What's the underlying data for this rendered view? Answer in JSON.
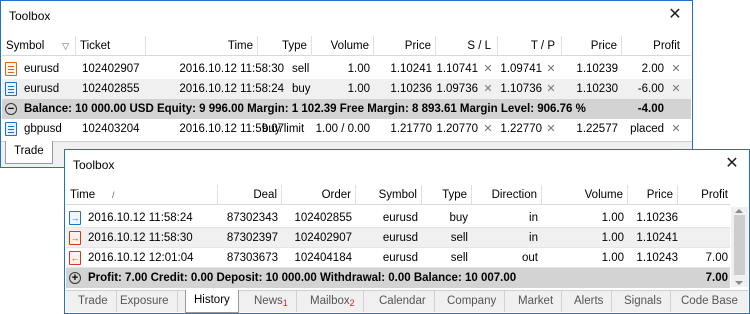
{
  "win1": {
    "title": "Toolbox",
    "headers": [
      "Symbol",
      "Ticket",
      "Time",
      "Type",
      "Volume",
      "Price",
      "S / L",
      "T / P",
      "Price",
      "Profit"
    ],
    "sort_arrow": "▽",
    "rows": [
      {
        "icon": "sell-order-icon",
        "symbol": "eurusd",
        "ticket": "102402907",
        "time": "2016.10.12 11:58:30",
        "type": "sell",
        "volume": "1.00",
        "price": "1.10241",
        "sl": "1.10741",
        "tp": "1.09741",
        "cur": "1.10239",
        "profit": "2.00"
      },
      {
        "icon": "buy-order-icon",
        "symbol": "eurusd",
        "ticket": "102402855",
        "time": "2016.10.12 11:58:24",
        "type": "buy",
        "volume": "1.00",
        "price": "1.10236",
        "sl": "1.09736",
        "tp": "1.10736",
        "cur": "1.10230",
        "profit": "-6.00"
      },
      {
        "icon": "pending-order-icon",
        "symbol": "gbpusd",
        "ticket": "102403204",
        "time": "2016.10.12 11:59:07",
        "type": "buy limit",
        "volume": "1.00 / 0.00",
        "price": "1.21770",
        "sl": "1.20770",
        "tp": "1.22770",
        "cur": "1.22577",
        "profit": "placed"
      }
    ],
    "summary": {
      "text": "Balance: 10 000.00 USD  Equity: 9 996.00  Margin: 1 102.39  Free Margin: 8 893.61  Margin Level: 906.76 %",
      "profit": "-4.00"
    },
    "tab": "Trade"
  },
  "win2": {
    "title": "Toolbox",
    "headers": [
      "Time",
      "Deal",
      "Order",
      "Symbol",
      "Type",
      "Direction",
      "Volume",
      "Price",
      "Profit"
    ],
    "sort_arrow": "/",
    "rows": [
      {
        "icon": "deal-in-icon",
        "time": "2016.10.12 11:58:24",
        "deal": "87302343",
        "order": "102402855",
        "symbol": "eurusd",
        "type": "buy",
        "direction": "in",
        "volume": "1.00",
        "price": "1.10236",
        "profit": ""
      },
      {
        "icon": "deal-in-icon",
        "time": "2016.10.12 11:58:30",
        "deal": "87302397",
        "order": "102402907",
        "symbol": "eurusd",
        "type": "sell",
        "direction": "in",
        "volume": "1.00",
        "price": "1.10241",
        "profit": ""
      },
      {
        "icon": "deal-out-icon",
        "time": "2016.10.12 12:01:04",
        "deal": "87303673",
        "order": "102404184",
        "symbol": "eurusd",
        "type": "sell",
        "direction": "out",
        "volume": "1.00",
        "price": "1.10243",
        "profit": "7.00"
      }
    ],
    "summary": {
      "text": "Profit: 7.00  Credit: 0.00  Deposit: 10 000.00  Withdrawal: 0.00  Balance: 10 007.00",
      "profit": "7.00"
    },
    "tabs": [
      {
        "label": "Trade",
        "badge": ""
      },
      {
        "label": "Exposure",
        "badge": ""
      },
      {
        "label": "History",
        "badge": ""
      },
      {
        "label": "News",
        "badge": "1"
      },
      {
        "label": "Mailbox",
        "badge": "2"
      },
      {
        "label": "Calendar",
        "badge": ""
      },
      {
        "label": "Company",
        "badge": ""
      },
      {
        "label": "Market",
        "badge": ""
      },
      {
        "label": "Alerts",
        "badge": ""
      },
      {
        "label": "Signals",
        "badge": ""
      },
      {
        "label": "Code Base",
        "badge": ""
      }
    ],
    "active_tab": "History"
  },
  "close_glyph": "✕",
  "remove_glyph": "✕",
  "colors": {
    "border": "#1e73c9",
    "summary_bg": "#d3d3d3",
    "sell": "#d2691e",
    "buy": "#1e73c9",
    "badge": "#dd2222"
  }
}
